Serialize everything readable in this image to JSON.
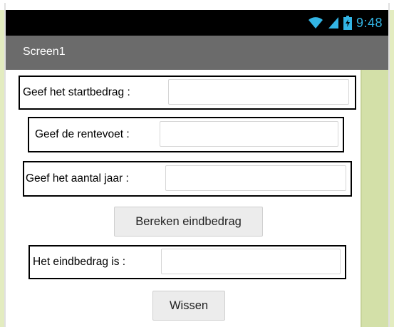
{
  "status": {
    "time": "9:48",
    "icons": [
      "wifi-icon",
      "signal-icon",
      "battery-icon"
    ],
    "accent_color": "#33b5e5"
  },
  "app": {
    "title": "Screen1"
  },
  "form": {
    "startbedrag_label": "Geef het startbedrag :",
    "startbedrag_value": "",
    "rentevoet_label": "Geef de rentevoet :",
    "rentevoet_value": "",
    "aantal_jaar_label": "Geef het aantal jaar :",
    "aantal_jaar_value": "",
    "bereken_button": "Bereken eindbedrag",
    "eindbedrag_label": "Het eindbedrag is :",
    "eindbedrag_value": "",
    "wissen_button": "Wissen"
  }
}
